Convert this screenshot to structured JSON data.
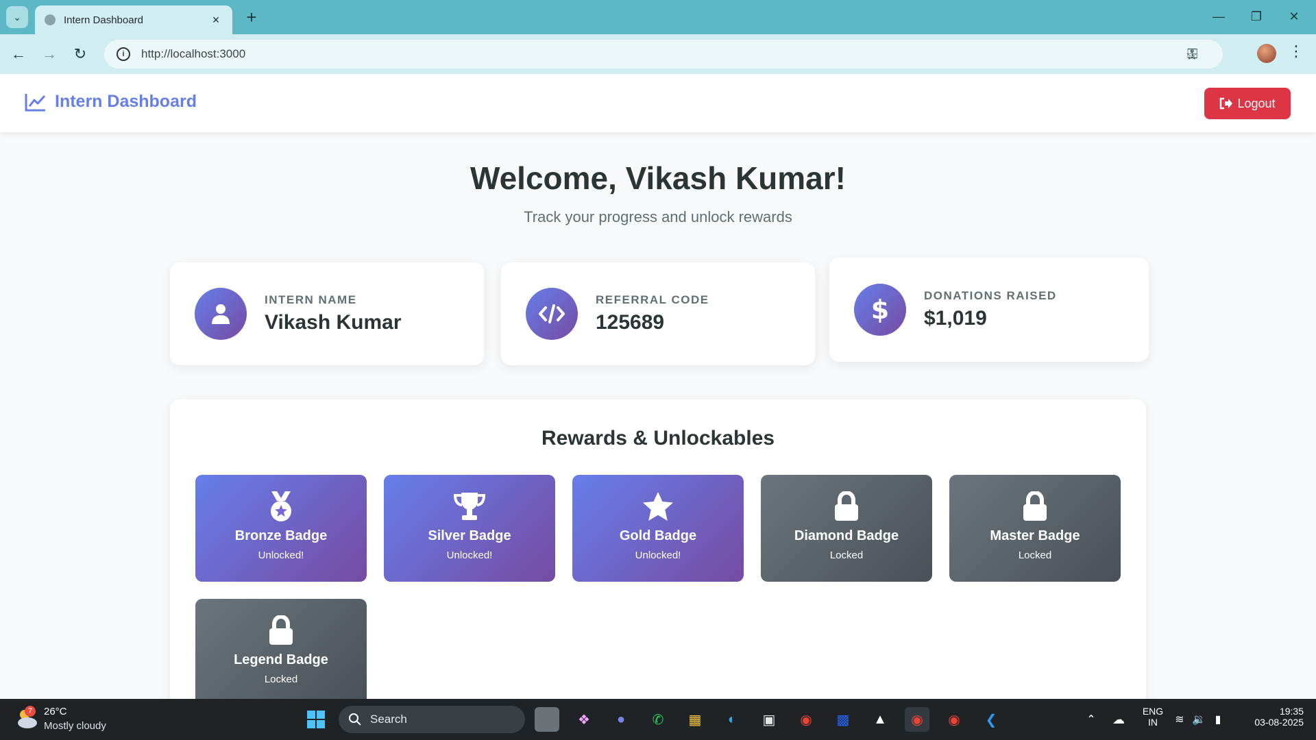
{
  "browser": {
    "tab_title": "Intern Dashboard",
    "url": "http://localhost:3000"
  },
  "navbar": {
    "brand": "Intern Dashboard",
    "logout_label": "Logout",
    "logout_color": "#dc3545",
    "brand_color": "#667eea"
  },
  "header": {
    "welcome": "Welcome, Vikash Kumar!",
    "subtitle": "Track your progress and unlock rewards"
  },
  "stats": [
    {
      "label": "Intern Name",
      "value": "Vikash Kumar",
      "icon": "user-icon"
    },
    {
      "label": "Referral Code",
      "value": "125689",
      "icon": "code-icon"
    },
    {
      "label": "Donations Raised",
      "value": "$1,019",
      "icon": "dollar-icon"
    }
  ],
  "rewards": {
    "title": "Rewards & Unlockables",
    "badges": [
      {
        "name": "Bronze Badge",
        "status": "Unlocked!",
        "icon": "medal-icon",
        "locked": false
      },
      {
        "name": "Silver Badge",
        "status": "Unlocked!",
        "icon": "trophy-icon",
        "locked": false
      },
      {
        "name": "Gold Badge",
        "status": "Unlocked!",
        "icon": "star-icon",
        "locked": false
      },
      {
        "name": "Diamond Badge",
        "status": "Locked",
        "icon": "lock-icon",
        "locked": true
      },
      {
        "name": "Master Badge",
        "status": "Locked",
        "icon": "lock-icon",
        "locked": true
      },
      {
        "name": "Legend Badge",
        "status": "Locked",
        "icon": "lock-icon",
        "locked": true
      }
    ]
  },
  "taskbar": {
    "weather_temp": "26°C",
    "weather_desc": "Mostly cloudy",
    "weather_badge": "7",
    "search_label": "Search",
    "lang_line1": "ENG",
    "lang_line2": "IN",
    "time": "19:35",
    "date": "03-08-2025"
  }
}
